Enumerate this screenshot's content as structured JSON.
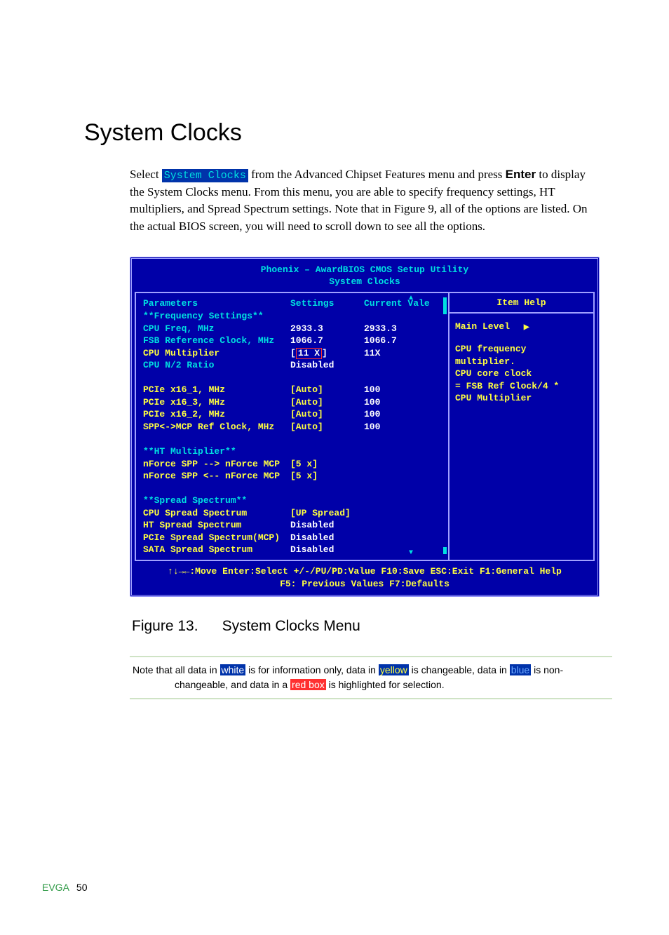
{
  "heading": "System Clocks",
  "intro": {
    "pre": "Select ",
    "mono": "System Clocks",
    "mid": " from the Advanced Chipset Features menu and press ",
    "bold": "Enter",
    "post": " to display the System Clocks menu. From this menu, you are able to specify frequency settings, HT multipliers, and Spread Spectrum settings. Note that in Figure 9, all of the options are listed. On the actual BIOS screen, you will need to scroll down to see all the options."
  },
  "bios": {
    "title1": "Phoenix – AwardBIOS CMOS Setup Utility",
    "title2": "System Clocks",
    "headers": {
      "param": "Parameters",
      "settings": "Settings",
      "current": "Current Val",
      "current_tail": "e"
    },
    "rows": [
      {
        "p": "**Frequency Settings**",
        "s": "",
        "c": "",
        "pc": "cyan",
        "sc": "",
        "cc": ""
      },
      {
        "p": "CPU Freq, MHz",
        "s": "2933.3",
        "c": "2933.3",
        "pc": "cyan",
        "sc": "white",
        "cc": "white"
      },
      {
        "p": "FSB Reference Clock, MHz",
        "s": "1066.7",
        "c": "1066.7",
        "pc": "cyan",
        "sc": "white",
        "cc": "white"
      },
      {
        "p": "CPU Multiplier",
        "s": "",
        "c": "11X",
        "pc": "yellow",
        "sc": "",
        "cc": "white",
        "special": "cpu_mult"
      },
      {
        "p": "CPU N/2 Ratio",
        "s": "Disabled",
        "c": "",
        "pc": "cyan",
        "sc": "white",
        "cc": ""
      },
      {
        "spacer": true
      },
      {
        "p": "PCIe x16_1, MHz",
        "s": "[Auto]",
        "c": "100",
        "pc": "yellow",
        "sc": "yellow",
        "cc": "white"
      },
      {
        "p": "PCIe x16_3, MHz",
        "s": "[Auto]",
        "c": "100",
        "pc": "yellow",
        "sc": "yellow",
        "cc": "white"
      },
      {
        "p": "PCIe x16_2, MHz",
        "s": "[Auto]",
        "c": "100",
        "pc": "yellow",
        "sc": "yellow",
        "cc": "white"
      },
      {
        "p": "SPP<->MCP Ref Clock, MHz",
        "s": "[Auto]",
        "c": "100",
        "pc": "yellow",
        "sc": "yellow",
        "cc": "white"
      },
      {
        "spacer": true
      },
      {
        "p": "**HT Multiplier**",
        "s": "",
        "c": "",
        "pc": "cyan"
      },
      {
        "p": "nForce SPP --> nForce MCP",
        "s": "[5 x]",
        "c": "",
        "pc": "yellow",
        "sc": "yellow"
      },
      {
        "p": "nForce SPP <-- nForce MCP",
        "s": "[5 x]",
        "c": "",
        "pc": "yellow",
        "sc": "yellow"
      },
      {
        "spacer": true
      },
      {
        "p": "**Spread Spectrum**",
        "s": "",
        "c": "",
        "pc": "cyan"
      },
      {
        "p": "CPU Spread Spectrum",
        "s": "[UP Spread]",
        "c": "",
        "pc": "yellow",
        "sc": "yellow"
      },
      {
        "p": "HT Spread Spectrum",
        "s": "Disabled",
        "c": "",
        "pc": "yellow",
        "sc": "white"
      },
      {
        "p": "PCIe Spread Spectrum(MCP)",
        "s": "Disabled",
        "c": "",
        "pc": "yellow",
        "sc": "white"
      },
      {
        "p": "SATA Spread Spectrum",
        "s": "Disabled",
        "c": "",
        "pc": "yellow",
        "sc": "white"
      }
    ],
    "cpu_mult_setting_inner": "11 X",
    "help": {
      "title": "Item Help",
      "main_level": "Main Level",
      "lines": [
        "CPU frequency multiplier.",
        "CPU core clock",
        "= FSB Ref Clock/4 *",
        "  CPU Multiplier"
      ]
    },
    "footer1": "↑↓→←:Move  Enter:Select  +/-/PU/PD:Value  F10:Save  ESC:Exit  F1:General Help",
    "footer2": "F5: Previous Values          F7:Defaults"
  },
  "figure": {
    "label": "Figure 13.",
    "title": "System Clocks Menu"
  },
  "note": {
    "t1": "Note that all data in ",
    "w": "white",
    "t2": " is for information only, data in ",
    "y": "yellow",
    "t3": " is changeable, data in ",
    "b": "blue",
    "t4": " is non-",
    "t5": "changeable, and data in a ",
    "r": "red box",
    "t6": " is highlighted for selection."
  },
  "footer": {
    "brand": "EVGA",
    "page": "50"
  }
}
